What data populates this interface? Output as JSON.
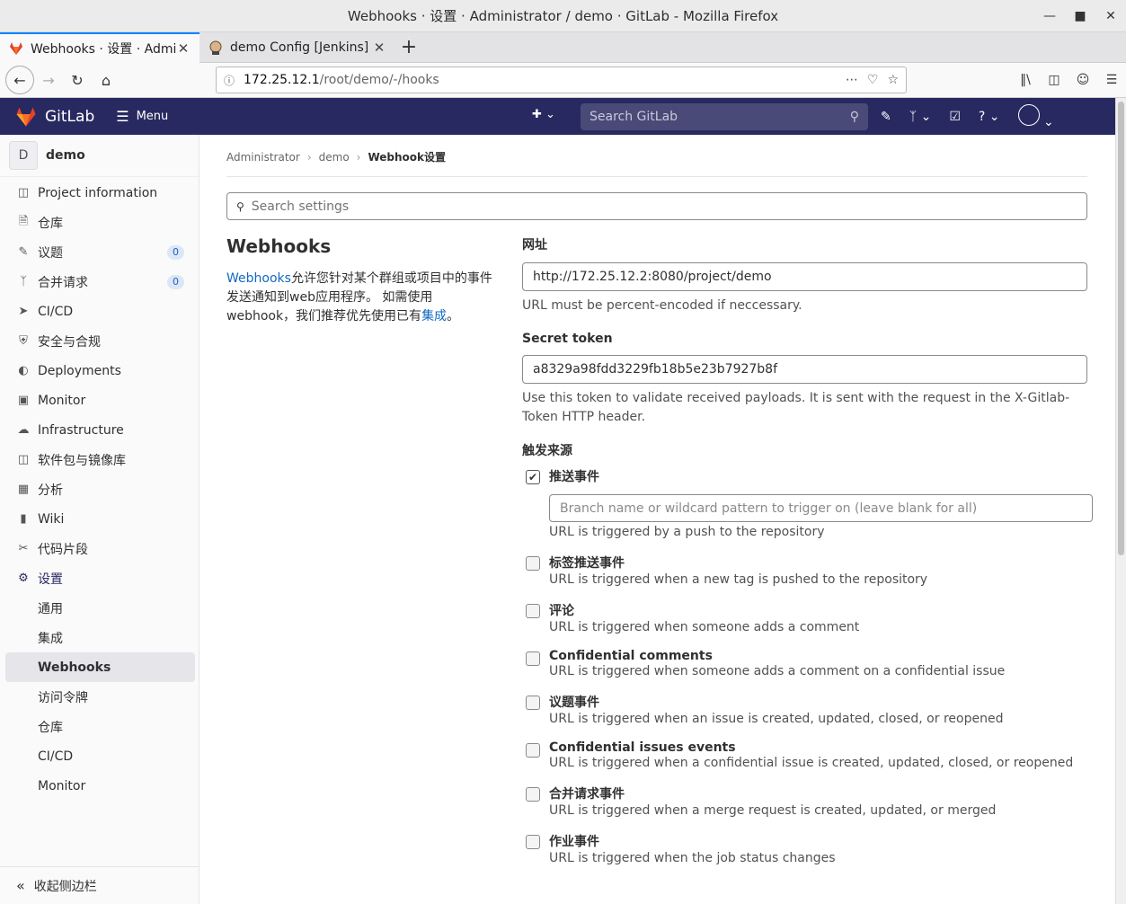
{
  "window": {
    "title": "Webhooks · 设置 · Administrator / demo · GitLab - Mozilla Firefox"
  },
  "tabs": [
    {
      "label": "Webhooks · 设置 · Admini",
      "active": true
    },
    {
      "label": "demo Config [Jenkins]",
      "active": false
    }
  ],
  "urlbar": {
    "host": "172.25.12.1",
    "path": "/root/demo/-/hooks"
  },
  "gitlab": {
    "brand": "GitLab",
    "menu_label": "Menu",
    "search_placeholder": "Search GitLab",
    "header_color": "#292961"
  },
  "sidebar": {
    "project_initial": "D",
    "project_name": "demo",
    "items": [
      {
        "label": "Project information",
        "icon": "info-icon"
      },
      {
        "label": "仓库",
        "icon": "document-icon"
      },
      {
        "label": "议题",
        "icon": "issues-icon",
        "badge": "0"
      },
      {
        "label": "合并请求",
        "icon": "merge-request-icon",
        "badge": "0"
      },
      {
        "label": "CI/CD",
        "icon": "rocket-icon"
      },
      {
        "label": "安全与合规",
        "icon": "shield-icon"
      },
      {
        "label": "Deployments",
        "icon": "deployments-icon"
      },
      {
        "label": "Monitor",
        "icon": "monitor-icon"
      },
      {
        "label": "Infrastructure",
        "icon": "cloud-icon"
      },
      {
        "label": "软件包与镜像库",
        "icon": "package-icon"
      },
      {
        "label": "分析",
        "icon": "chart-icon"
      },
      {
        "label": "Wiki",
        "icon": "book-icon"
      },
      {
        "label": "代码片段",
        "icon": "scissors-icon"
      },
      {
        "label": "设置",
        "icon": "gear-icon"
      }
    ],
    "settings_sub": [
      "通用",
      "集成",
      "Webhooks",
      "访问令牌",
      "仓库",
      "CI/CD",
      "Monitor"
    ],
    "collapse_label": "收起侧边栏"
  },
  "breadcrumb": {
    "a": "Administrator",
    "b": "demo",
    "current": "Webhook设置"
  },
  "search_settings": {
    "placeholder": "Search settings"
  },
  "intro": {
    "title": "Webhooks",
    "link1": "Webhooks",
    "text1": "允许您针对某个群组或项目中的事件发送通知到web应用程序。 如需使用webhook，我们推荐优先使用已有",
    "link2": "集成",
    "text2": "。"
  },
  "form": {
    "url_label": "网址",
    "url_value": "http://172.25.12.2:8080/project/demo",
    "url_help": "URL must be percent-encoded if neccessary.",
    "token_label": "Secret token",
    "token_value": "a8329a98fdd3229fb18b5e23b7927b8f",
    "token_help": "Use this token to validate received payloads. It is sent with the request in the X-Gitlab-Token HTTP header.",
    "trigger_label": "触发来源",
    "branch_placeholder": "Branch name or wildcard pattern to trigger on (leave blank for all)",
    "triggers": [
      {
        "title": "推送事件",
        "help": "URL is triggered by a push to the repository",
        "checked": true
      },
      {
        "title": "标签推送事件",
        "help": "URL is triggered when a new tag is pushed to the repository",
        "checked": false
      },
      {
        "title": "评论",
        "help": "URL is triggered when someone adds a comment",
        "checked": false
      },
      {
        "title": "Confidential comments",
        "help": "URL is triggered when someone adds a comment on a confidential issue",
        "checked": false
      },
      {
        "title": "议题事件",
        "help": "URL is triggered when an issue is created, updated, closed, or reopened",
        "checked": false
      },
      {
        "title": "Confidential issues events",
        "help": "URL is triggered when a confidential issue is created, updated, closed, or reopened",
        "checked": false
      },
      {
        "title": "合并请求事件",
        "help": "URL is triggered when a merge request is created, updated, or merged",
        "checked": false
      },
      {
        "title": "作业事件",
        "help": "URL is triggered when the job status changes",
        "checked": false
      }
    ]
  }
}
